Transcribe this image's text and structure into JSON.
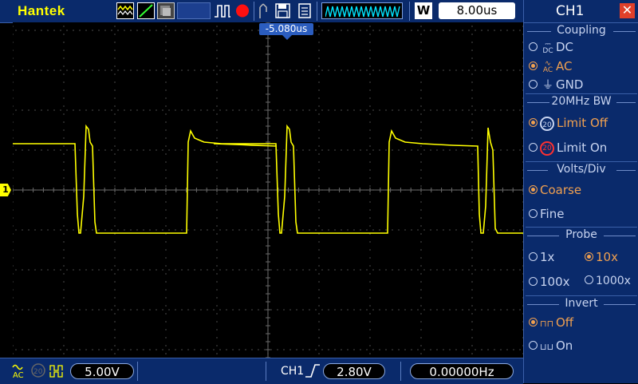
{
  "topbar": {
    "brand": "Hantek",
    "timebase_w": "W",
    "timebase_value": "8.00us"
  },
  "screen": {
    "trigger_position": "-5.080us",
    "ch1_marker": "1",
    "colors": {
      "trace": "#ffff00",
      "grid": "#6b6b6b",
      "background": "#000000"
    }
  },
  "bottombar": {
    "volts_div": "5.00V",
    "trigger_channel": "CH1",
    "trigger_level": "2.80V",
    "frequency": "0.00000Hz"
  },
  "panel": {
    "title": "CH1",
    "close_icon": "close-icon",
    "coupling": {
      "title": "Coupling",
      "options": [
        {
          "label": "DC",
          "selected": false
        },
        {
          "label": "AC",
          "selected": true
        },
        {
          "label": "GND",
          "selected": false
        }
      ]
    },
    "bw": {
      "title": "20MHz BW",
      "options": [
        {
          "label": "Limit Off",
          "selected": true
        },
        {
          "label": "Limit On",
          "selected": false
        }
      ]
    },
    "volts": {
      "title": "Volts/Div",
      "options": [
        {
          "label": "Coarse",
          "selected": true
        },
        {
          "label": "Fine",
          "selected": false
        }
      ]
    },
    "probe": {
      "title": "Probe",
      "options": [
        {
          "label": "1x",
          "selected": false
        },
        {
          "label": "10x",
          "selected": true
        },
        {
          "label": "100x",
          "selected": false
        },
        {
          "label": "1000x",
          "selected": false
        }
      ]
    },
    "invert": {
      "title": "Invert",
      "options": [
        {
          "label": "Off",
          "selected": true
        },
        {
          "label": "On",
          "selected": false
        }
      ]
    }
  }
}
